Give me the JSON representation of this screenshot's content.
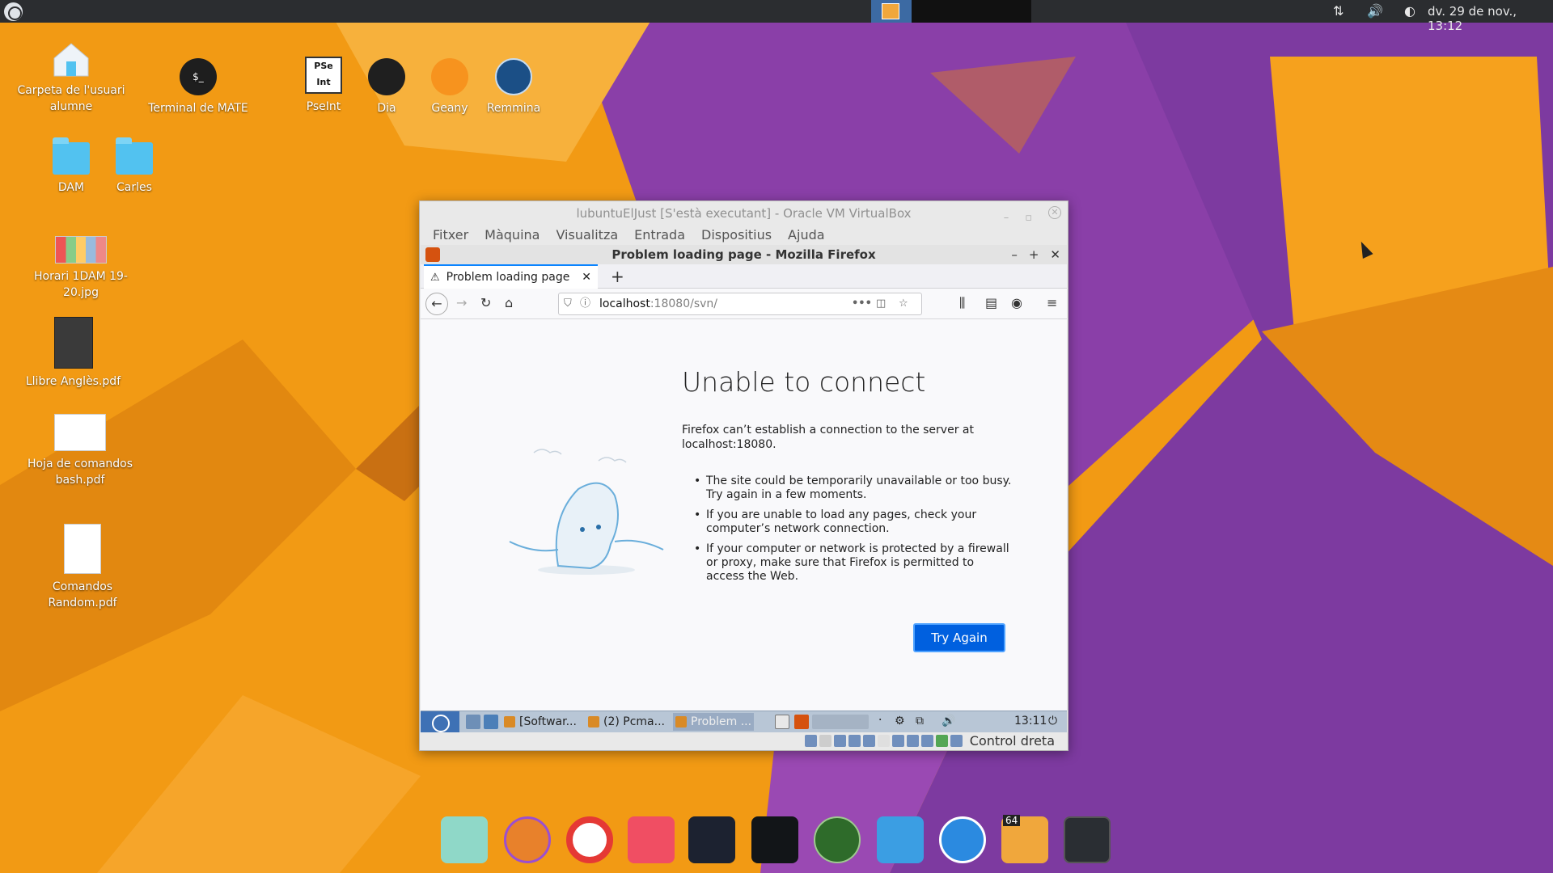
{
  "colors": {
    "wallpaper_orange": "#f29a14",
    "wallpaper_purple": "#7b3a9e",
    "panel_bg": "#2b2d30",
    "firefox_accent": "#0060df"
  },
  "top_panel": {
    "clock": "dv. 29 de nov., 13:12",
    "tray_icons": [
      "network-icon",
      "volume-icon",
      "night-mode-icon"
    ]
  },
  "desktop_icons": [
    {
      "label": "Carpeta de l'usuari alumne",
      "icon": "home-folder-icon"
    },
    {
      "label": "Terminal de MATE",
      "icon": "terminal-icon"
    },
    {
      "label": "PseInt",
      "icon": "pseint-icon"
    },
    {
      "label": "Dia",
      "icon": "dia-icon"
    },
    {
      "label": "Geany",
      "icon": "geany-icon"
    },
    {
      "label": "Remmina",
      "icon": "remmina-icon"
    },
    {
      "label": "DAM",
      "icon": "folder-icon"
    },
    {
      "label": "Carles",
      "icon": "folder-icon"
    },
    {
      "label": "Horari 1DAM 19-20.jpg",
      "icon": "image-file-icon"
    },
    {
      "label": "Llibre Anglès.pdf",
      "icon": "pdf-file-icon"
    },
    {
      "label": "Hoja de comandos bash.pdf",
      "icon": "pdf-file-icon"
    },
    {
      "label": "Comandos Random.pdf",
      "icon": "pdf-file-icon"
    }
  ],
  "terminal_glyph": "$_",
  "pseint_glyph_top": "PSe",
  "pseint_glyph_bottom": "Int",
  "vbox": {
    "title": "lubuntuElJust [S'està executant] - Oracle VM VirtualBox",
    "menu": [
      "Fitxer",
      "Màquina",
      "Visualitza",
      "Entrada",
      "Dispositius",
      "Ajuda"
    ],
    "status_label": "Control dreta"
  },
  "firefox": {
    "window_title": "Problem loading page - Mozilla Firefox",
    "tab_title": "Problem loading page",
    "url_host": "localhost",
    "url_path": ":18080/svn/",
    "error_title": "Unable to connect",
    "error_desc": "Firefox can’t establish a connection to the server at localhost:18080.",
    "bullets": [
      "The site could be temporarily unavailable or too busy. Try again in a few moments.",
      "If you are unable to load any pages, check your computer’s network connection.",
      "If your computer or network is protected by a firewall or proxy, make sure that Firefox is permitted to access the Web."
    ],
    "try_again": "Try Again"
  },
  "guest_taskbar": {
    "tasks": [
      "[Softwar...",
      "(2) Pcma...",
      "Problem ..."
    ],
    "clock": "13:11"
  },
  "dock": [
    {
      "icon": "files-icon"
    },
    {
      "icon": "firefox-icon"
    },
    {
      "icon": "screen-recorder-icon"
    },
    {
      "icon": "toggle-app-icon"
    },
    {
      "icon": "ide-icon"
    },
    {
      "icon": "terminal-app-icon"
    },
    {
      "icon": "radar-icon"
    },
    {
      "icon": "window-app-icon"
    },
    {
      "icon": "monitor-app-icon"
    },
    {
      "icon": "virtualbox-icon"
    },
    {
      "icon": "terminal-icon"
    }
  ],
  "dock_badge": "64"
}
